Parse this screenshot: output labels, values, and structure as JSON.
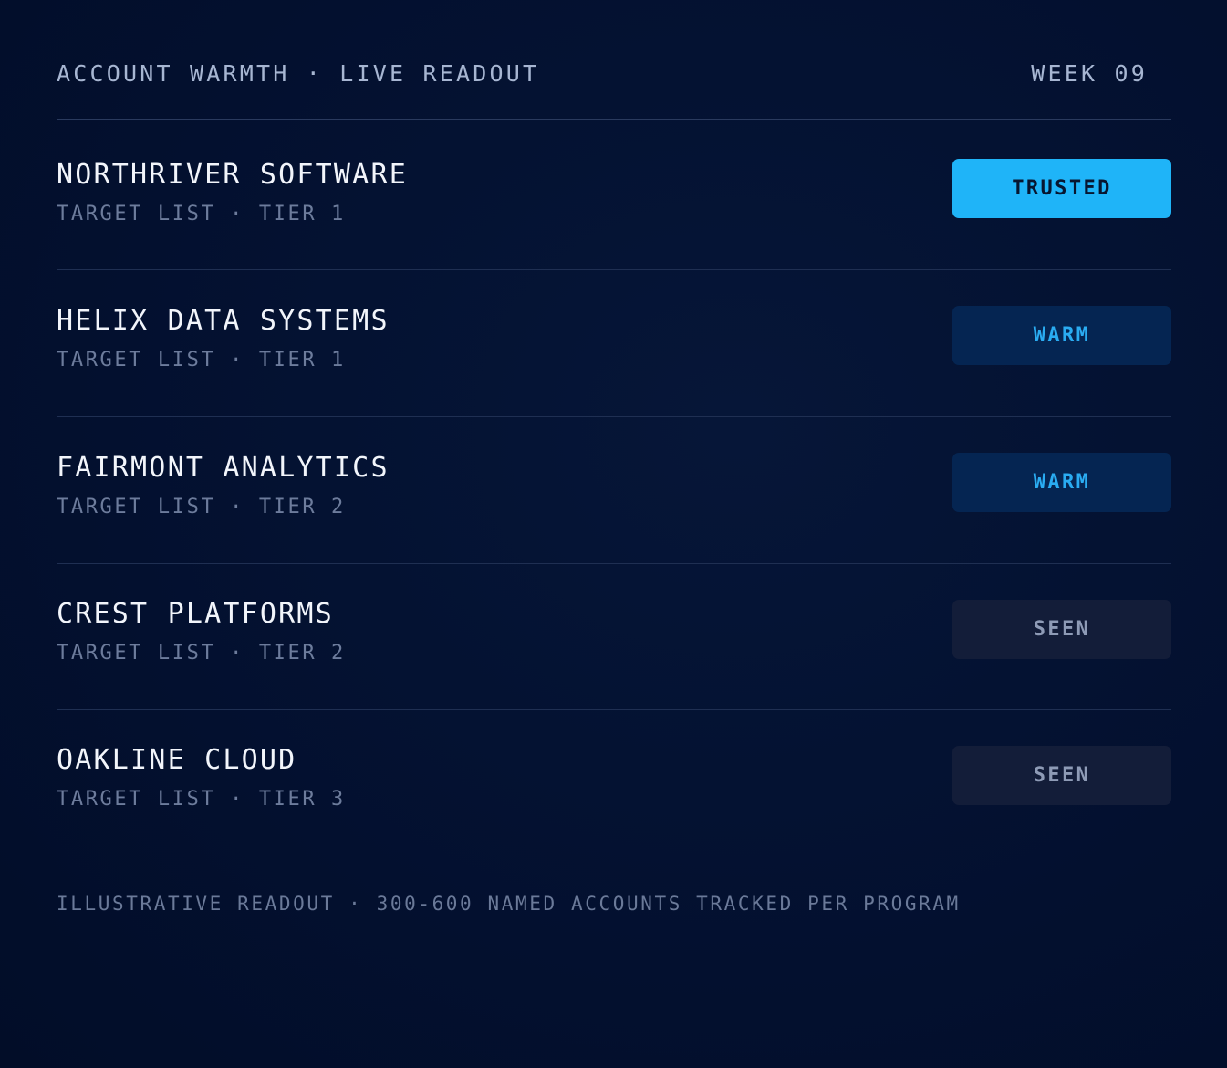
{
  "header": {
    "title": "ACCOUNT WARMTH · LIVE READOUT",
    "week": "WEEK 09"
  },
  "accounts": [
    {
      "name": "NORTHRIVER SOFTWARE",
      "meta": "TARGET LIST · TIER 1",
      "status": "TRUSTED"
    },
    {
      "name": "HELIX DATA SYSTEMS",
      "meta": "TARGET LIST · TIER 1",
      "status": "WARM"
    },
    {
      "name": "FAIRMONT ANALYTICS",
      "meta": "TARGET LIST · TIER 2",
      "status": "WARM"
    },
    {
      "name": "CREST PLATFORMS",
      "meta": "TARGET LIST · TIER 2",
      "status": "SEEN"
    },
    {
      "name": "OAKLINE CLOUD",
      "meta": "TARGET LIST · TIER 3",
      "status": "SEEN"
    }
  ],
  "footnote": "ILLUSTRATIVE READOUT · 300-600 NAMED ACCOUNTS TRACKED PER PROGRAM",
  "colors": {
    "background": "#031030",
    "trusted_badge": "#1fb4f8",
    "warm_badge": "#052552",
    "warm_text": "#2aacf2",
    "seen_badge": "#131d39",
    "seen_text": "#8e9bb6"
  }
}
